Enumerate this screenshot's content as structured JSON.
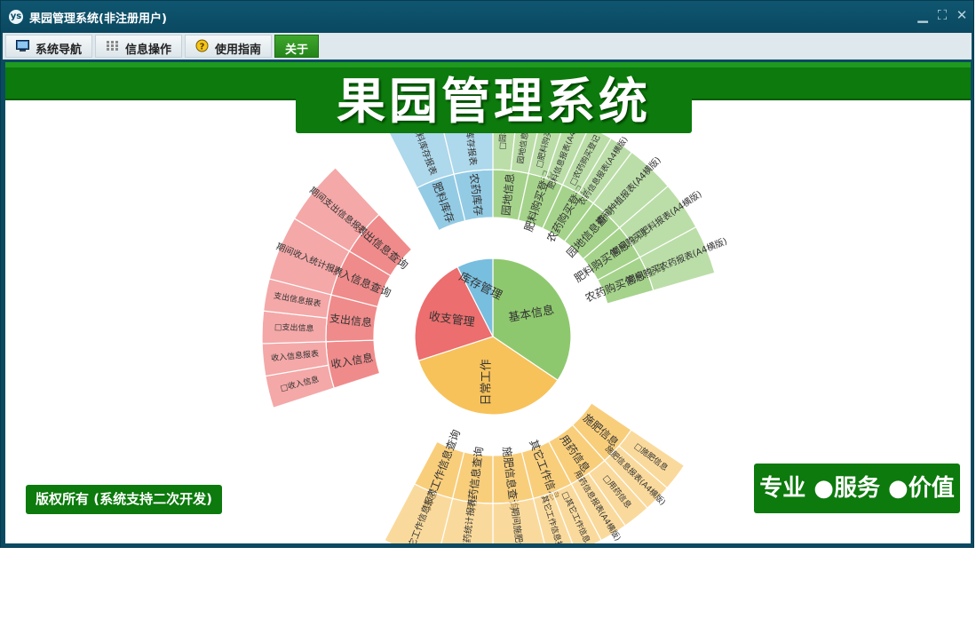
{
  "window": {
    "title": "果园管理系统(非注册用户)",
    "app_icon": "ys"
  },
  "menu": {
    "items": [
      {
        "label": "系统导航",
        "icon": "monitor-icon"
      },
      {
        "label": "信息操作",
        "icon": "grid-icon"
      },
      {
        "label": "使用指南",
        "icon": "help-globe-icon"
      },
      {
        "label": "关于",
        "icon": "",
        "active": true
      }
    ]
  },
  "main": {
    "banner": "果园管理系统",
    "copyright": "版权所有 (系统支持二次开发)",
    "slogan": "专业 ●服务 ●价值"
  },
  "colors": {
    "green": "#0c7a0c",
    "titlebar": "#0b4a63",
    "base_info": "#8ec86e",
    "daily_work": "#f7c25a",
    "income_expense": "#ec6e6e",
    "inventory": "#78bede"
  },
  "chart_data": {
    "type": "sunburst",
    "center_labels": [
      "基本信息",
      "日常工作",
      "收支管理",
      "库存管理"
    ],
    "sectors": [
      {
        "name": "基本信息",
        "children": [
          {
            "name": "园地信息",
            "leaves": [
              "□园地",
              "园地信息报表"
            ]
          },
          {
            "name": "肥料购买登记",
            "leaves": [
              "□肥料购买登",
              "肥料信息报表(A4横版)"
            ]
          },
          {
            "name": "农药购买登记",
            "leaves": [
              "□农药购买登记",
              "农药信息报表(A4横版)"
            ]
          },
          {
            "name": "园地信息查询",
            "leaves": [
              "期间种植报表(A4横版)"
            ]
          },
          {
            "name": "肥料购买信息查询",
            "leaves": [
              "期间购买肥料报表(A4横版)"
            ]
          },
          {
            "name": "农药购买信息查询",
            "leaves": [
              "期间购买农药报表(A4横版)"
            ]
          }
        ]
      },
      {
        "name": "日常工作",
        "children": [
          {
            "name": "施肥信息",
            "leaves": [
              "□施肥信息",
              "施肥信息报表(A4横版)"
            ]
          },
          {
            "name": "用药信息",
            "leaves": [
              "□用药信息",
              "用药信息报表(A4横版)"
            ]
          },
          {
            "name": "其它工作信息",
            "leaves": [
              "□其它工作信息",
              "其它工作信息报表"
            ]
          },
          {
            "name": "施肥信息查询",
            "leaves": [
              "期间施肥统计"
            ]
          },
          {
            "name": "用药信息查询",
            "leaves": [
              "期间用药统计报表"
            ]
          },
          {
            "name": "其它工作信息查询",
            "leaves": [
              "其它工作信息报表"
            ]
          }
        ]
      },
      {
        "name": "收支管理",
        "children": [
          {
            "name": "收入信息",
            "leaves": [
              "□收入信息",
              "收入信息报表"
            ]
          },
          {
            "name": "支出信息",
            "leaves": [
              "□支出信息",
              "支出信息报表"
            ]
          },
          {
            "name": "收入信息查询",
            "leaves": [
              "期间收入统计报表"
            ]
          },
          {
            "name": "支出信息查询",
            "leaves": [
              "期间支出信息报表"
            ]
          }
        ]
      },
      {
        "name": "库存管理",
        "children": [
          {
            "name": "肥料库存",
            "leaves": [
              "肥料库存报表"
            ]
          },
          {
            "name": "农药库存",
            "leaves": [
              "农药库存报表"
            ]
          }
        ]
      }
    ]
  }
}
